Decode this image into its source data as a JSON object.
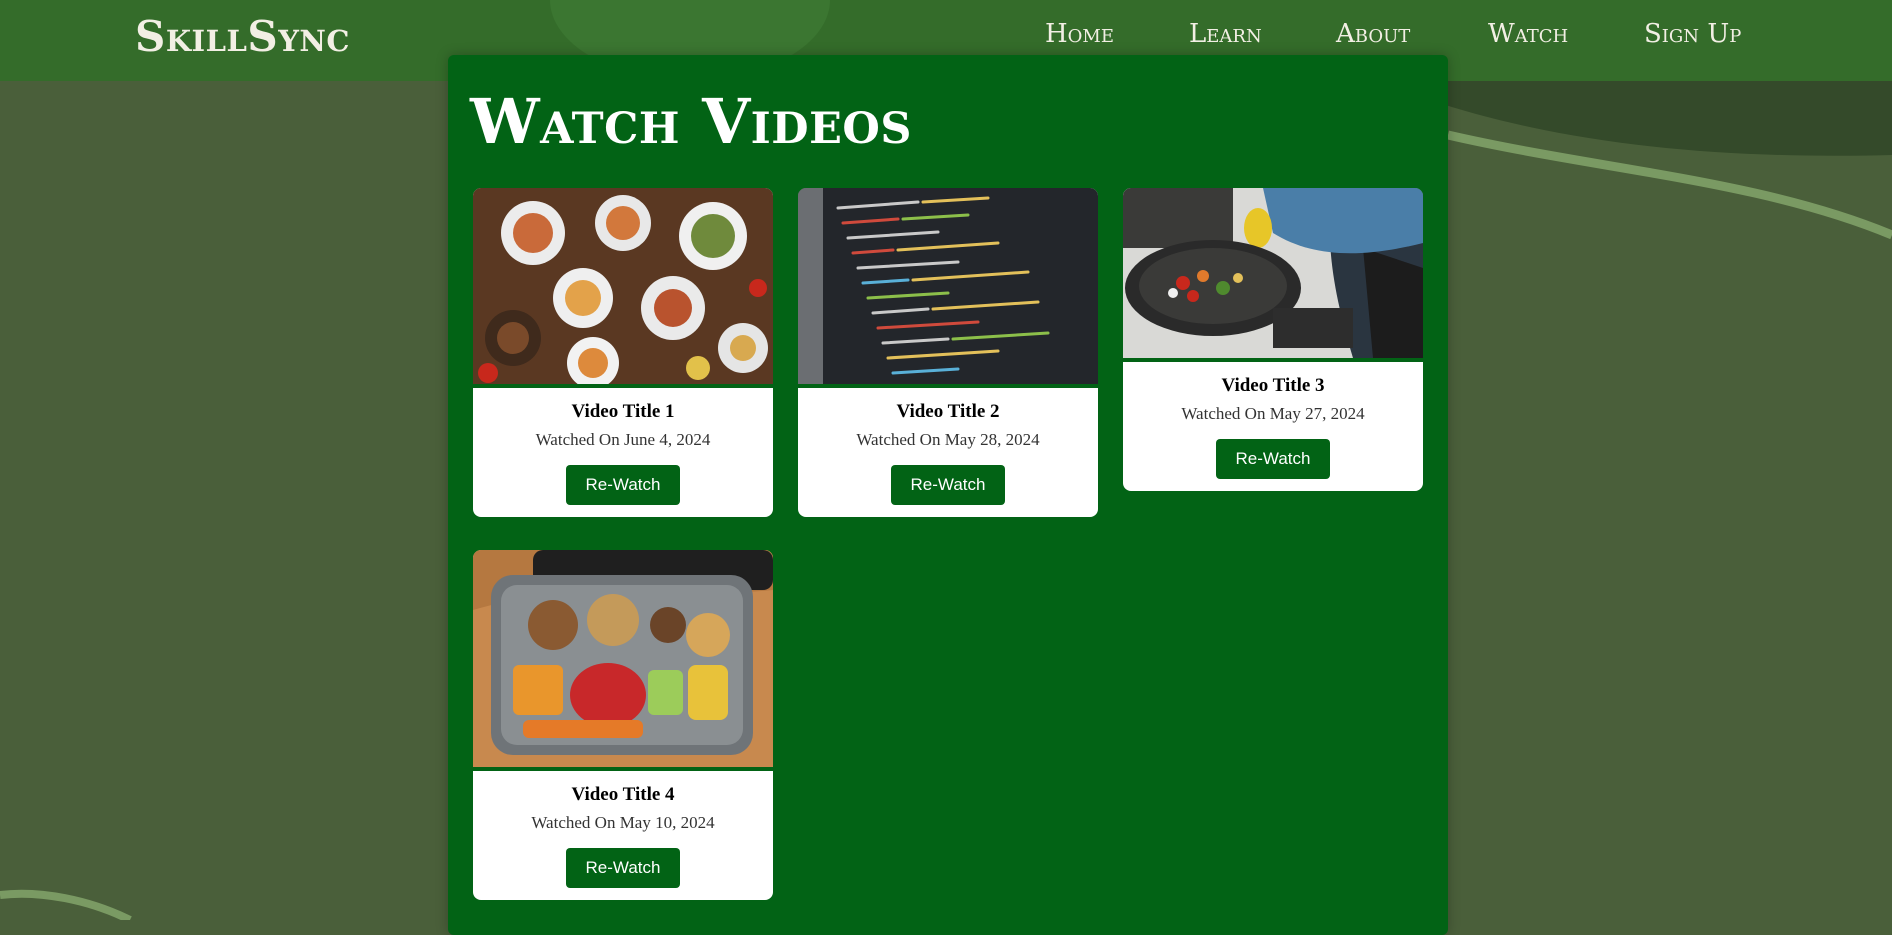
{
  "brand": "SkillSync",
  "nav": {
    "items": [
      "Home",
      "Learn",
      "About",
      "Watch",
      "Sign Up"
    ]
  },
  "page": {
    "title": "Watch Videos"
  },
  "videos": [
    {
      "title": "Video Title 1",
      "watched": "Watched On June 4, 2024",
      "button": "Re-Watch",
      "thumbnail": "food-platter-image"
    },
    {
      "title": "Video Title 2",
      "watched": "Watched On May 28, 2024",
      "button": "Re-Watch",
      "thumbnail": "code-screen-image"
    },
    {
      "title": "Video Title 3",
      "watched": "Watched On May 27, 2024",
      "button": "Re-Watch",
      "thumbnail": "wok-cooking-image"
    },
    {
      "title": "Video Title 4",
      "watched": "Watched On May 10, 2024",
      "button": "Re-Watch",
      "thumbnail": "lunchbox-image"
    }
  ],
  "colors": {
    "background": "#4a5f3a",
    "navbar": "#346c2a",
    "panel": "#026315",
    "button": "#026315",
    "card": "#ffffff"
  }
}
